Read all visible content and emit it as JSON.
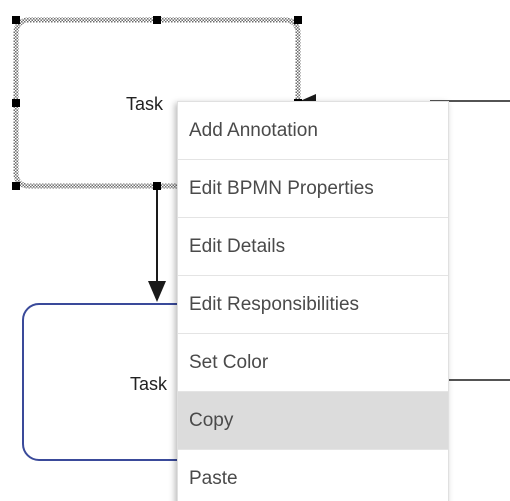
{
  "diagram": {
    "task_1": {
      "label": "Task"
    },
    "task_2": {
      "label": "Task"
    }
  },
  "context_menu": {
    "items": [
      {
        "label": "Add Annotation",
        "highlighted": false
      },
      {
        "label": "Edit BPMN Properties",
        "highlighted": false
      },
      {
        "label": "Edit Details",
        "highlighted": false
      },
      {
        "label": "Edit Responsibilities",
        "highlighted": false
      },
      {
        "label": "Set Color",
        "highlighted": false
      },
      {
        "label": "Copy",
        "highlighted": true
      },
      {
        "label": "Paste",
        "highlighted": false
      }
    ]
  },
  "colors": {
    "selected_task_border": "#7a7a7a",
    "task_border": "#3a4a9a",
    "connector": "#1a1a1a",
    "menu_highlight": "#dcdcdc"
  }
}
